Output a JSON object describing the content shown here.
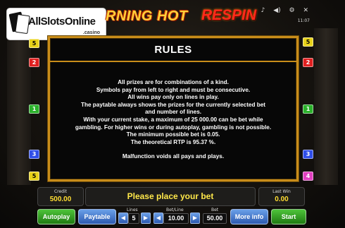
{
  "header": {
    "logo_text": "AllSlotsOnline",
    "logo_tld": ".casino",
    "title": "BURNING HOT",
    "title_visible_part": "RNING HOT",
    "respin": "RESPIN",
    "icons": [
      "music-icon",
      "sound-icon",
      "settings-icon",
      "close-icon"
    ],
    "clock": "11:07"
  },
  "paylines": {
    "left": [
      "5",
      "2",
      "",
      "",
      "1",
      "",
      "3",
      "5"
    ],
    "right": [
      "5",
      "2",
      "",
      "1",
      "",
      "3",
      "4"
    ],
    "colors": {
      "1": "#2bb12b",
      "2": "#e02020",
      "3": "#2f4ee8",
      "4": "#e040c0",
      "5": "#e8d21a"
    }
  },
  "rules": {
    "heading": "RULES",
    "lines": [
      "All prizes are for combinations of a kind.",
      "Symbols pay from left to right and must be consecutive.",
      "All wins pay only on lines in play.",
      "The paytable always shows the prizes for the currently selected bet",
      "and number of lines.",
      "With your current stake, a maximum of 25 000.00 can be bet while",
      "gambling. For higher wins or during autoplay, gambling is not possible.",
      "The minimum possible bet is 0.05.",
      "The theoretical RTP is 95.37 %."
    ],
    "footer": "Malfunction voids all pays and plays."
  },
  "status": {
    "credit_label": "Credit",
    "credit_value": "500.00",
    "message": "Please place your bet",
    "last_win_label": "Last Win",
    "last_win_value": "0.00"
  },
  "controls": {
    "autoplay": "Autoplay",
    "paytable": "Paytable",
    "lines_label": "Lines",
    "lines_value": "5",
    "betline_label": "Bet/Line",
    "betline_value": "10.00",
    "bet_label": "Bet",
    "bet_value": "50.00",
    "more_info": "More info",
    "start": "Start"
  }
}
